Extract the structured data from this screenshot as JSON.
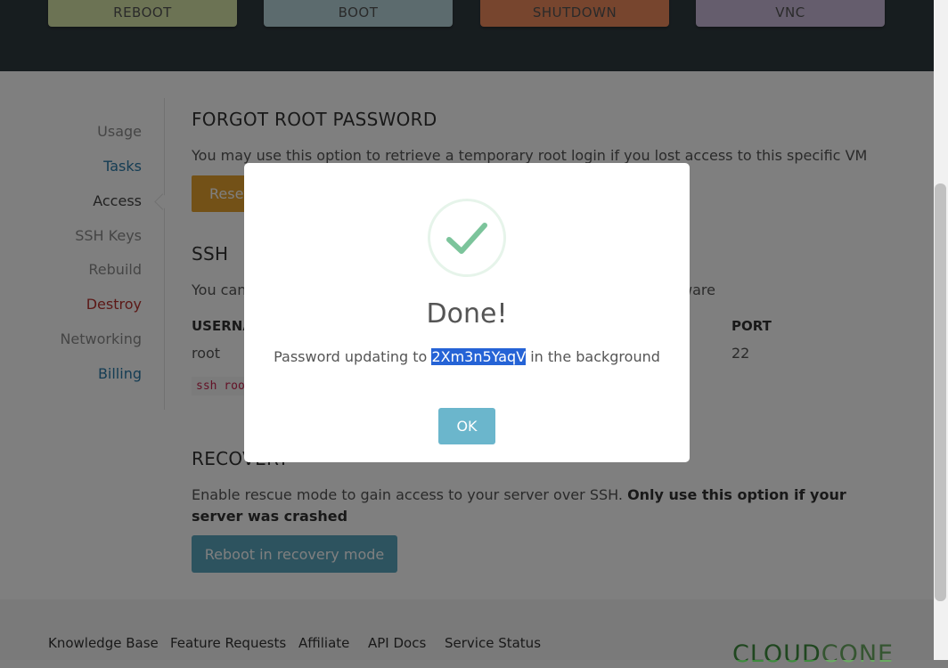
{
  "power_buttons": {
    "reboot": "REBOOT",
    "boot": "BOOT",
    "shutdown": "SHUTDOWN",
    "vnc": "VNC"
  },
  "sidebar": {
    "items": [
      {
        "label": "Usage"
      },
      {
        "label": "Tasks"
      },
      {
        "label": "Access"
      },
      {
        "label": "SSH Keys"
      },
      {
        "label": "Rebuild"
      },
      {
        "label": "Destroy"
      },
      {
        "label": "Networking"
      },
      {
        "label": "Billing"
      }
    ]
  },
  "forgot": {
    "title": "FORGOT ROOT PASSWORD",
    "description": "You may use this option to retrieve a temporary root login if you lost access to this specific VM",
    "button": "Reset"
  },
  "ssh": {
    "title": "SSH",
    "desc_start": "You can",
    "desc_end": "ware",
    "headers": {
      "username": "USERNA",
      "port": "PORT"
    },
    "row": {
      "username": "root",
      "port": "22"
    },
    "command": "ssh roo"
  },
  "recovery": {
    "title": "RECOVERY",
    "desc": "Enable rescue mode to gain access to your server over SSH.",
    "desc_bold": "Only use this option if your server was crashed",
    "button": "Reboot in recovery mode"
  },
  "footer": {
    "links": [
      "Knowledge Base",
      "Feature Requests",
      "Affiliate",
      "API Docs",
      "Service Status"
    ],
    "brand_part1": "CLOUD",
    "brand_part2": "CONE"
  },
  "modal": {
    "title": "Done!",
    "text_before": "Password updating to",
    "password": "2Xm3n5YaqV",
    "text_after": "in the background",
    "ok_label": "OK"
  },
  "colors": {
    "topbar": "#2f3a3f",
    "reset_button": "#e6a32e",
    "recovery_button": "#5aa6be",
    "ok_button": "#6bb6cc",
    "success_check": "#7cc49b",
    "selection": "#2563d6"
  }
}
